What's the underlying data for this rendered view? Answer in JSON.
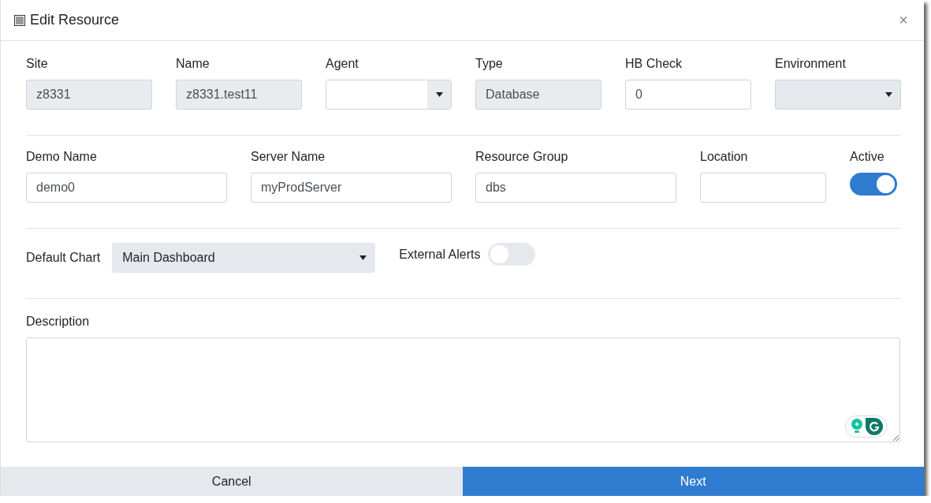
{
  "window": {
    "title": "Edit Resource",
    "close": "×"
  },
  "row_1": [
    {
      "label": "Site",
      "kind": "readonly",
      "value": "z8331"
    },
    {
      "label": "Name",
      "kind": "readonly",
      "value": "z8331.test11"
    },
    {
      "label": "Agent",
      "kind": "select",
      "disabled": false
    },
    {
      "label": "Type",
      "kind": "readonly",
      "value": "Database"
    },
    {
      "label": "HB Check",
      "kind": "input",
      "value": "0"
    },
    {
      "label": "Environment",
      "kind": "select",
      "disabled": true
    }
  ],
  "row_2": [
    {
      "label": "Demo Name",
      "kind": "input",
      "value": "demo0"
    },
    {
      "label": "Server Name",
      "kind": "input",
      "value": "myProdServer"
    },
    {
      "label": "Resource Group",
      "kind": "input",
      "value": "dbs"
    },
    {
      "label": "Location",
      "kind": "input"
    },
    {
      "label": "Active",
      "kind": "toggle",
      "on": true
    }
  ],
  "default_chart": {
    "label": "Default Chart",
    "value": "Main Dashboard"
  },
  "external_alerts": {
    "label": "External Alerts",
    "on": false
  },
  "description": {
    "label": "Description"
  },
  "buttons": [
    {
      "label": "Cancel",
      "kind": "secondary"
    },
    {
      "label": "Next",
      "kind": "primary"
    }
  ]
}
